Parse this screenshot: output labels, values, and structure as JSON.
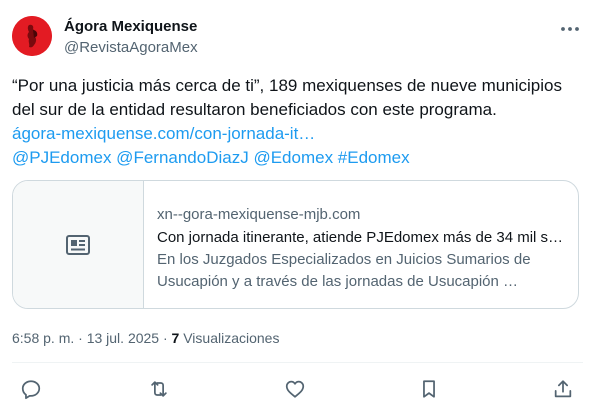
{
  "author": {
    "display_name": "Ágora Mexiquense",
    "handle": "@RevistaAgoraMex"
  },
  "tweet": {
    "line1": "“Por una justicia más cerca de ti”, 189 mexiquenses de nueve municipios",
    "line2": "del sur de la entidad resultaron beneficiados con este programa.",
    "link": "ágora-mexiquense.com/con-jornada-it…",
    "mentions": "@PJEdomex @FernandoDiazJ @Edomex #Edomex"
  },
  "card": {
    "domain": "xn--gora-mexiquense-mjb.com",
    "title": "Con jornada itinerante, atiende PJEdomex más de 34 mil s…",
    "desc_line1": "En los Juzgados Especializados en Juicios Sumarios de",
    "desc_line2": "Usucapión y a través de las jornadas de Usucapión …"
  },
  "meta": {
    "timestamp": "6:58 p. m. · 13 jul. 2025 · ",
    "views_count": "7",
    "views_label": " Visualizaciones"
  },
  "icons": {
    "more": "more-horizontal-icon",
    "thumb": "article-icon",
    "reply": "reply-icon",
    "retweet": "retweet-icon",
    "like": "like-icon",
    "bookmark": "bookmark-icon",
    "share": "share-icon"
  },
  "colors": {
    "link": "#1d9bf0",
    "text": "#0f1419",
    "secondary": "#536471",
    "avatar": "#e31b23"
  }
}
